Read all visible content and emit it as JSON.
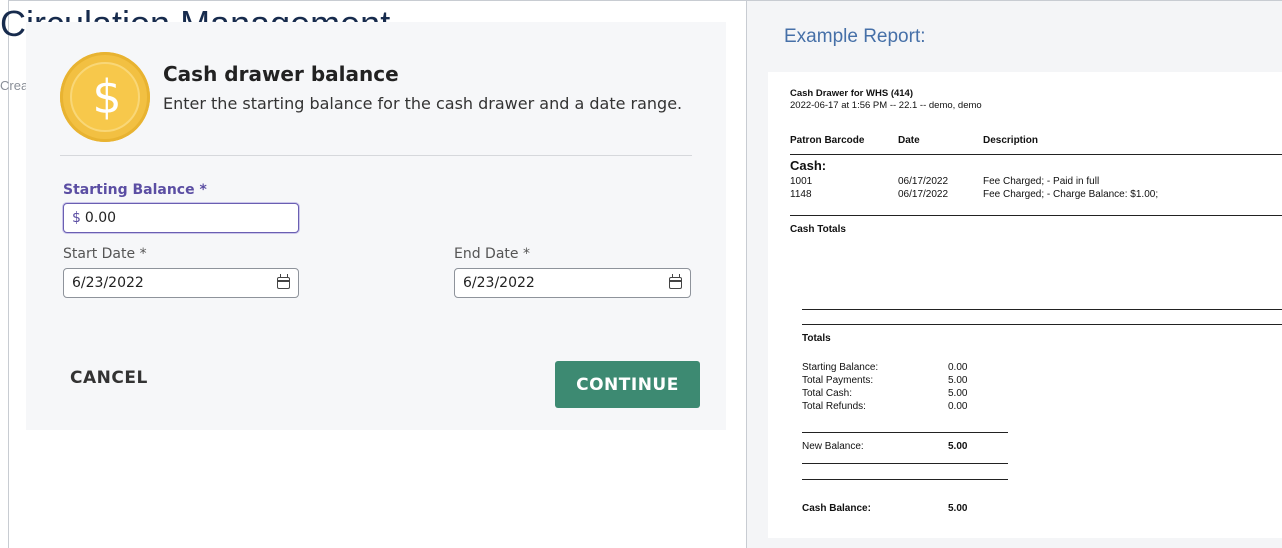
{
  "background": {
    "heading": "Circulation Management",
    "meta": "Created"
  },
  "dialog": {
    "icon": "dollar-coin-icon",
    "icon_glyph": "$",
    "title": "Cash drawer balance",
    "subtitle": "Enter the starting balance for the cash drawer and a date range.",
    "starting_balance": {
      "label": "Starting Balance *",
      "prefix": "$",
      "value": "0.00"
    },
    "start_date": {
      "label": "Start Date *",
      "value": "6/23/2022"
    },
    "end_date": {
      "label": "End Date *",
      "value": "6/23/2022"
    },
    "cancel_label": "CANCEL",
    "continue_label": "CONTINUE",
    "continue_color": "#3d8a72"
  },
  "example": {
    "label": "Example Report:",
    "report": {
      "title": "Cash Drawer for WHS (414)",
      "subtitle": "2022-06-17 at 1:56 PM -- 22.1  -- demo, demo",
      "columns": [
        "Patron Barcode",
        "Date",
        "Description"
      ],
      "section": "Cash:",
      "rows": [
        {
          "barcode": "1001",
          "date": "06/17/2022",
          "description": "Fee Charged; - Paid in full"
        },
        {
          "barcode": "1148",
          "date": "06/17/2022",
          "description": "Fee Charged; - Charge Balance: $1.00;"
        }
      ],
      "cash_totals": "Cash Totals",
      "totals_heading": "Totals",
      "totals": [
        {
          "label": "Starting Balance:",
          "value": "0.00"
        },
        {
          "label": "Total Payments:",
          "value": "5.00"
        },
        {
          "label": "Total Cash:",
          "value": "5.00"
        },
        {
          "label": "Total Refunds:",
          "value": "0.00"
        }
      ],
      "new_balance": {
        "label": "New Balance:",
        "value": "5.00"
      },
      "cash_balance": {
        "label": "Cash Balance:",
        "value": "5.00"
      }
    }
  }
}
